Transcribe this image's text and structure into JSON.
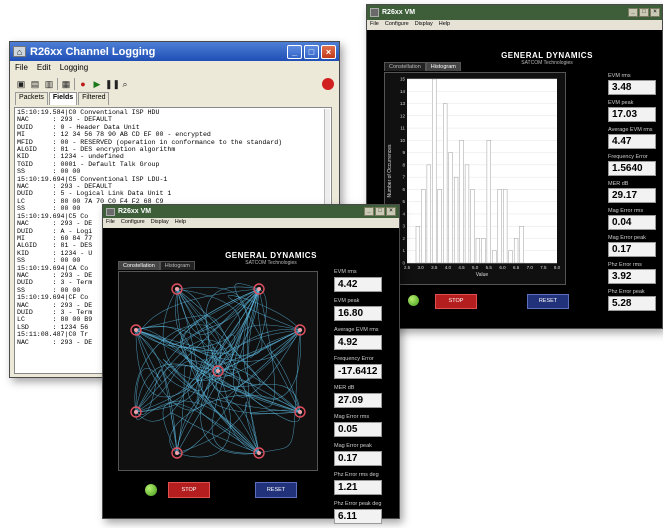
{
  "log_window": {
    "title": "R26xx Channel Logging",
    "window_buttons": [
      "_",
      "□",
      "×"
    ],
    "menu": [
      "File",
      "Edit",
      "Logging"
    ],
    "tabs": [
      "Packets",
      "Fields",
      "Filtered"
    ],
    "active_tab": "Fields",
    "lines": [
      "15:10:19.584|C0 Conventional ISP HDU",
      "NAC      : 293 - DEFAULT",
      "DUID     : 0 - Header Data Unit",
      "MI       : 12 34 56 78 90 AB CD EF 00 - encrypted",
      "MFID     : 00 - RESERVED (operation in conformance to the standard)",
      "ALGID    : 81 - DES encryption algorithm",
      "KID      : 1234 - undefined",
      "TGID     : 0001 - Default Talk Group",
      "SS       : 00 00",
      "",
      "15:10:19.694|C5 Conventional ISP LDU-1",
      "NAC      : 293 - DEFAULT",
      "DUID     : 5 - Logical Link Data Unit 1",
      "LC       : 80 00 7A 70 C0 F4 F2 68 C9",
      "SS       : 00 00",
      "",
      "15:10:19.694|C5 Co",
      "NAC      : 293 - DE",
      "DUID     : A - Logi",
      "MI       : 60 84 77",
      "ALGID    : 81 - DES",
      "KID      : 1234 - U",
      "SS       : 00 00",
      "",
      "15:10:19.694|CA Co",
      "NAC      : 293 - DE",
      "DUID     : 3 - Term",
      "SS       : 00 00",
      "",
      "15:10:19.694|CF Co",
      "NAC      : 293 - DE",
      "DUID     : 3 - Term",
      "LC       : 80 00 B9",
      "LSD      : 1234 56",
      "",
      "15:11:08.487|C0 Tr",
      "NAC      : 293 - DE"
    ]
  },
  "vm_back": {
    "title": "R26xx VM",
    "menu": [
      "File",
      "Configure",
      "Display",
      "Help"
    ],
    "logo_name": "GENERAL DYNAMICS",
    "logo_sub": "SATCOM Technologies",
    "tabs": [
      "Constellation",
      "Histogram"
    ],
    "active_tab": "Histogram",
    "stats": [
      {
        "label": "EVM rms",
        "value": "3.48"
      },
      {
        "label": "EVM peak",
        "value": "17.03"
      },
      {
        "label": "Average EVM rms",
        "value": "4.47"
      },
      {
        "label": "Frequency Error",
        "value": "1.5640"
      },
      {
        "label": "MER dB",
        "value": "29.17"
      },
      {
        "label": "Mag Error rms",
        "value": "0.04"
      },
      {
        "label": "Mag Error peak",
        "value": "0.17"
      },
      {
        "label": "Phz Error rms",
        "value": "3.92"
      },
      {
        "label": "Phz Error peak",
        "value": "5.28"
      }
    ],
    "stop_label": "STOP",
    "reset_label": "RESET",
    "led_color": "#55c11e",
    "stop_color": "#b41e1e",
    "reset_color": "#22327a"
  },
  "vm_front": {
    "title": "R26xx VM",
    "menu": [
      "File",
      "Configure",
      "Display",
      "Help"
    ],
    "logo_name": "GENERAL DYNAMICS",
    "logo_sub": "SATCOM Technologies",
    "tabs": [
      "Constellation",
      "Histogram"
    ],
    "active_tab": "Constellation",
    "stats": [
      {
        "label": "EVM rms",
        "value": "4.42"
      },
      {
        "label": "EVM peak",
        "value": "16.80"
      },
      {
        "label": "Average EVM rms",
        "value": "4.92"
      },
      {
        "label": "Frequency Error",
        "value": "-17.6412"
      },
      {
        "label": "MER dB",
        "value": "27.09"
      },
      {
        "label": "Mag Error rms",
        "value": "0.05"
      },
      {
        "label": "Mag Error peak",
        "value": "0.17"
      },
      {
        "label": "Phz Error rms deg",
        "value": "1.21"
      },
      {
        "label": "Phz Error peak deg",
        "value": "6.11"
      }
    ],
    "stop_label": "STOP",
    "reset_label": "RESET",
    "trace_color": "#5bb8e0",
    "symbol_color": "#e05060"
  },
  "chart_data": [
    {
      "type": "bar",
      "ylabel": "Number of Occurrences",
      "xlabel": "Value",
      "xlim": [
        2.5,
        8.0
      ],
      "ylim": [
        0,
        15
      ],
      "xticks": [
        "2.5",
        "3.0",
        "3.5",
        "4.0",
        "4.5",
        "5.0",
        "5.5",
        "6.0",
        "6.5",
        "7.0",
        "7.5",
        "8.0"
      ],
      "yticks": [
        "0",
        "1",
        "2",
        "3",
        "4",
        "5",
        "6",
        "7",
        "8",
        "9",
        "10",
        "11",
        "12",
        "13",
        "14",
        "15"
      ],
      "bins": [
        2.9,
        3.1,
        3.3,
        3.5,
        3.7,
        3.9,
        4.1,
        4.3,
        4.5,
        4.7,
        4.9,
        5.1,
        5.3,
        5.5,
        5.7,
        5.9,
        6.1,
        6.3,
        6.5,
        6.7
      ],
      "values": [
        3,
        6,
        8,
        15,
        6,
        13,
        9,
        7,
        10,
        8,
        6,
        2,
        2,
        10,
        1,
        6,
        6,
        1,
        2,
        3
      ]
    },
    {
      "type": "scatter",
      "title": "",
      "symbol_points": [
        [
          0.5,
          1.0
        ],
        [
          -0.5,
          1.0
        ],
        [
          1.0,
          0.5
        ],
        [
          -1.0,
          0.5
        ],
        [
          1.0,
          -0.5
        ],
        [
          -1.0,
          -0.5
        ],
        [
          0.5,
          -1.0
        ],
        [
          -0.5,
          -1.0
        ],
        [
          0.0,
          0.0
        ]
      ]
    }
  ]
}
